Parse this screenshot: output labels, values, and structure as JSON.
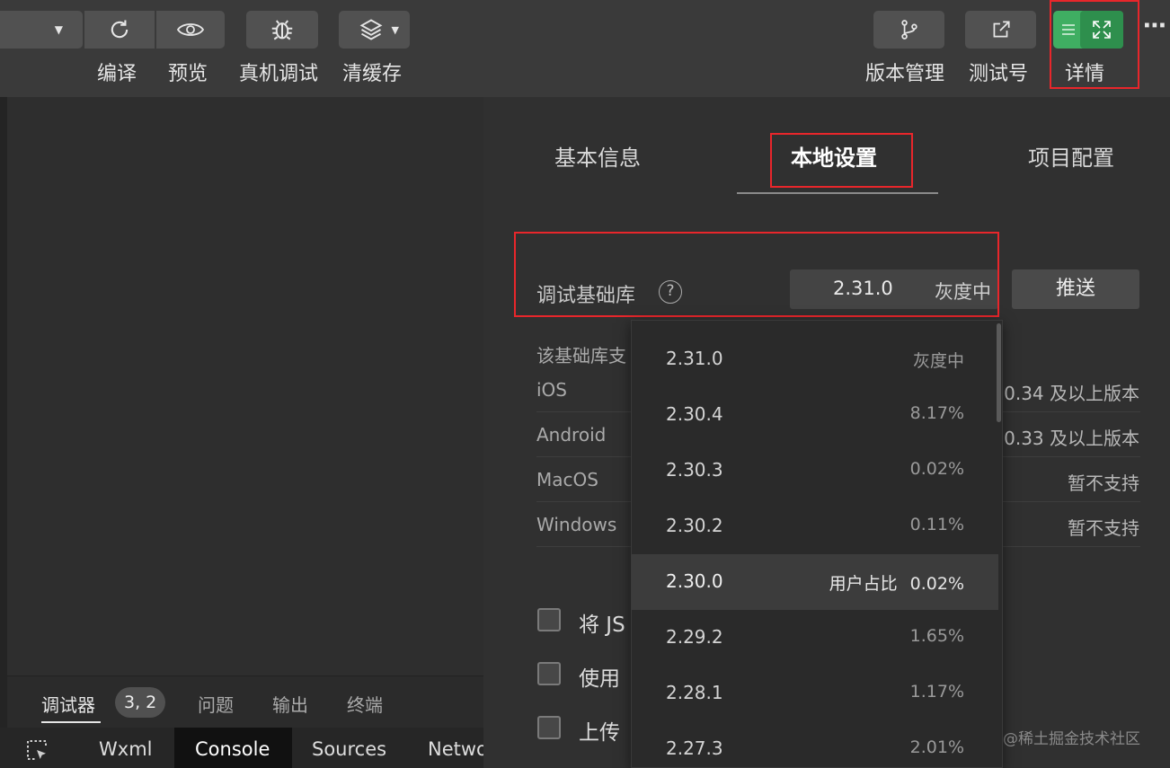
{
  "toolbar": {
    "compile_label": "编译",
    "preview_label": "预览",
    "remote_debug_label": "真机调试",
    "clear_cache_label": "清缓存",
    "version_label": "版本管理",
    "testno_label": "测试号",
    "details_label": "详情",
    "more_label": "⋯"
  },
  "panel": {
    "tabs": [
      "基本信息",
      "本地设置",
      "项目配置"
    ],
    "active_tab": "本地设置",
    "lib_label": "调试基础库",
    "lib_version": "2.31.0",
    "lib_status": "灰度中",
    "push_label": "推送",
    "support_label": "该基础库支",
    "platforms": [
      {
        "name": "iOS",
        "value": "0.34 及以上版本"
      },
      {
        "name": "Android",
        "value": "0.33 及以上版本"
      },
      {
        "name": "MacOS",
        "value": "暂不支持"
      },
      {
        "name": "Windows",
        "value": "暂不支持"
      }
    ],
    "options": [
      "将 JS",
      "使用",
      "上传"
    ]
  },
  "dropdown": {
    "items": [
      {
        "version": "2.31.0",
        "pct": "灰度中"
      },
      {
        "version": "2.30.4",
        "pct": "8.17%"
      },
      {
        "version": "2.30.3",
        "pct": "0.02%"
      },
      {
        "version": "2.30.2",
        "pct": "0.11%"
      },
      {
        "version": "2.30.0",
        "pct": "0.02%",
        "prefix": "用户占比"
      },
      {
        "version": "2.29.2",
        "pct": "1.65%"
      },
      {
        "version": "2.28.1",
        "pct": "1.17%"
      },
      {
        "version": "2.27.3",
        "pct": "2.01%"
      }
    ],
    "highlighted": "2.30.0"
  },
  "bottom": {
    "tabs": [
      "调试器",
      "问题",
      "输出",
      "终端"
    ],
    "debugger_badge": "3, 2",
    "devtools_tabs": [
      "Wxml",
      "Console",
      "Sources",
      "Netwo"
    ]
  },
  "watermark": "@稀土掘金技术社区",
  "colors": {
    "accent_green": "#3fae62",
    "highlight": "#e8262b"
  }
}
